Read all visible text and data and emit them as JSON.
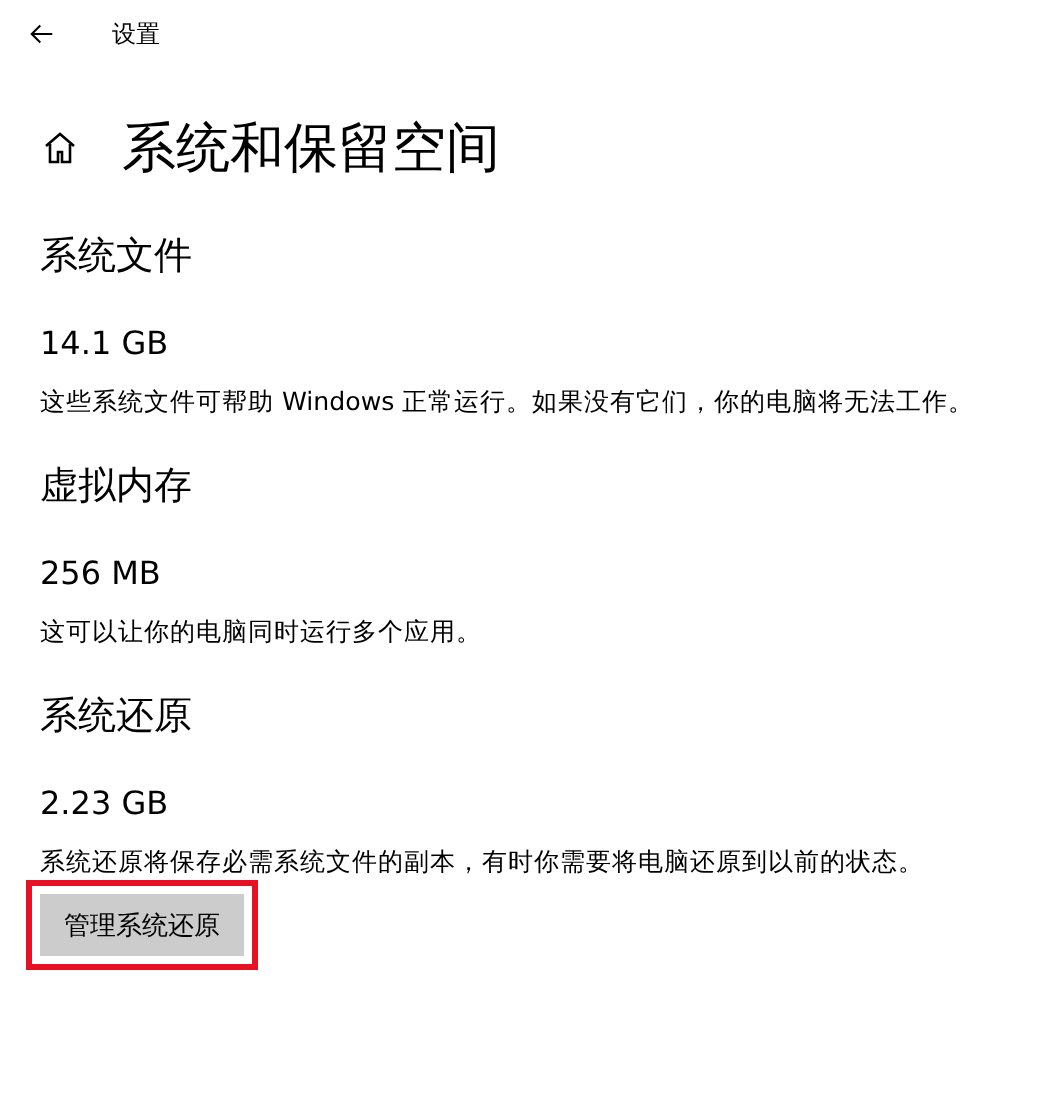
{
  "window": {
    "title": "设置"
  },
  "page": {
    "title": "系统和保留空间"
  },
  "sections": [
    {
      "heading": "系统文件",
      "value": "14.1 GB",
      "description": "这些系统文件可帮助 Windows 正常运行。如果没有它们，你的电脑将无法工作。"
    },
    {
      "heading": "虚拟内存",
      "value": "256 MB",
      "description": "这可以让你的电脑同时运行多个应用。"
    },
    {
      "heading": "系统还原",
      "value": "2.23 GB",
      "description": "系统还原将保存必需系统文件的副本，有时你需要将电脑还原到以前的状态。",
      "button": {
        "label": "管理系统还原",
        "highlighted": true
      }
    }
  ]
}
